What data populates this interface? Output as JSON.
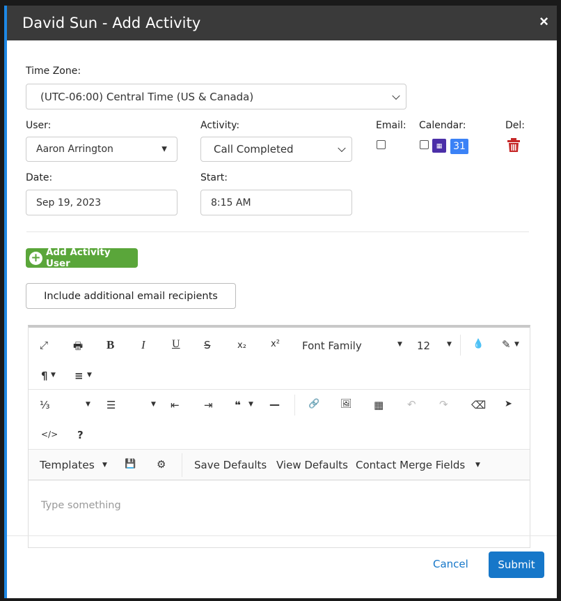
{
  "modal": {
    "title": "David Sun - Add Activity",
    "close_glyph": "×"
  },
  "timezone": {
    "label": "Time Zone:",
    "value": "(UTC-06:00) Central Time (US & Canada)"
  },
  "row1": {
    "user_label": "User:",
    "user_value": "Aaron Arrington",
    "activity_label": "Activity:",
    "activity_value": "Call Completed",
    "email_label": "Email:",
    "calendar_label": "Calendar:",
    "del_label": "Del:",
    "google_calendar_day": "31"
  },
  "row2": {
    "date_label": "Date:",
    "date_value": "Sep 19, 2023",
    "start_label": "Start:",
    "start_value": "8:15 AM"
  },
  "buttons": {
    "add_user": "Add Activity User",
    "include_recipients": "Include additional email recipients",
    "cancel": "Cancel",
    "submit": "Submit"
  },
  "editor": {
    "font_family": "Font Family",
    "font_size": "12",
    "templates": "Templates",
    "save_defaults": "Save Defaults",
    "view_defaults": "View Defaults",
    "merge_fields": "Contact Merge Fields",
    "placeholder": "Type something",
    "icons": {
      "fullscreen": "⤢",
      "print": "🖶",
      "bold": "B",
      "italic": "I",
      "underline": "U",
      "strike": "S",
      "subscript": "x₂",
      "superscript": "x²",
      "color": "💧",
      "magic": "✎",
      "paragraph": "¶",
      "align": "≡",
      "ol": "⅓",
      "ul": "☰",
      "outdent": "⇤",
      "indent": "⇥",
      "quote": "❝",
      "hr": "—",
      "link": "🔗",
      "image": "🖼",
      "table": "▦",
      "undo": "↶",
      "redo": "↷",
      "eraser": "⌫",
      "pointer": "➤",
      "code": "</>",
      "help": "?",
      "save": "💾",
      "gear": "⚙"
    }
  }
}
